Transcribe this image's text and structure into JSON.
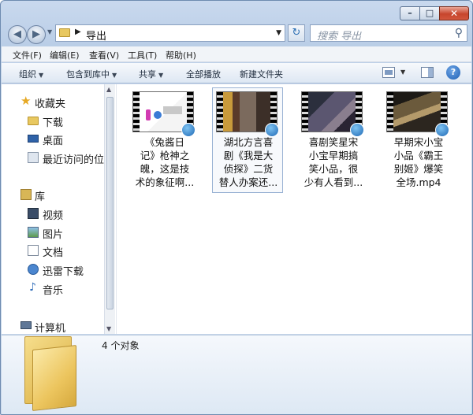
{
  "window": {
    "controls": {
      "minimize": "–",
      "maximize": "□",
      "close": "✕"
    }
  },
  "nav": {
    "back_glyph": "◀",
    "forward_glyph": "▶",
    "dropdown_glyph": "▼"
  },
  "address": {
    "separator": "▶",
    "path": "导出",
    "dropdown_glyph": "▼",
    "refresh_glyph": "↻"
  },
  "search": {
    "placeholder": "搜索 导出",
    "icon_glyph": "⚲"
  },
  "menubar": {
    "items": [
      "文件(F)",
      "编辑(E)",
      "查看(V)",
      "工具(T)",
      "帮助(H)"
    ]
  },
  "toolbar": {
    "items": [
      {
        "label": "组织",
        "arrow": "▼"
      },
      {
        "label": "包含到库中",
        "arrow": "▼"
      },
      {
        "label": "共享",
        "arrow": "▼"
      },
      {
        "label": "全部播放",
        "arrow": ""
      },
      {
        "label": "新建文件夹",
        "arrow": ""
      }
    ],
    "view_dropdown_glyph": "▼",
    "help_label": "?"
  },
  "sidebar": {
    "items": [
      {
        "label": "收藏夹",
        "icon": "star-icon"
      },
      {
        "label": "下载",
        "icon": "folder-icon"
      },
      {
        "label": "桌面",
        "icon": "desktop-icon"
      },
      {
        "label": "最近访问的位",
        "icon": "recent-places-icon"
      },
      {
        "label": "库",
        "icon": "library-icon"
      },
      {
        "label": "视频",
        "icon": "video-library-icon"
      },
      {
        "label": "图片",
        "icon": "pictures-library-icon"
      },
      {
        "label": "文档",
        "icon": "documents-library-icon"
      },
      {
        "label": "迅雷下载",
        "icon": "thunder-download-icon"
      },
      {
        "label": "音乐",
        "icon": "music-library-icon"
      },
      {
        "label": "计算机",
        "icon": "computer-icon"
      }
    ],
    "scroll_up": "▲",
    "scroll_down": "▼"
  },
  "files": [
    {
      "label": "《兔酱日\n记》枪神之\n魄，这是技\n术的象征啊...",
      "selected": false
    },
    {
      "label": "湖北方言喜\n剧《我是大\n侦探》二货\n替人办案还...",
      "selected": true
    },
    {
      "label": "喜剧笑星宋\n小宝早期搞\n笑小品，很\n少有人看到...",
      "selected": false
    },
    {
      "label": "早期宋小宝\n小品《霸王\n别姬》爆笑\n全场.mp4",
      "selected": false
    }
  ],
  "status": {
    "count": "4 个对象"
  },
  "colors": {
    "accent": "#2c6fb3",
    "selection_border": "#9ab3d4",
    "window_chrome": "#c9d9ee"
  }
}
